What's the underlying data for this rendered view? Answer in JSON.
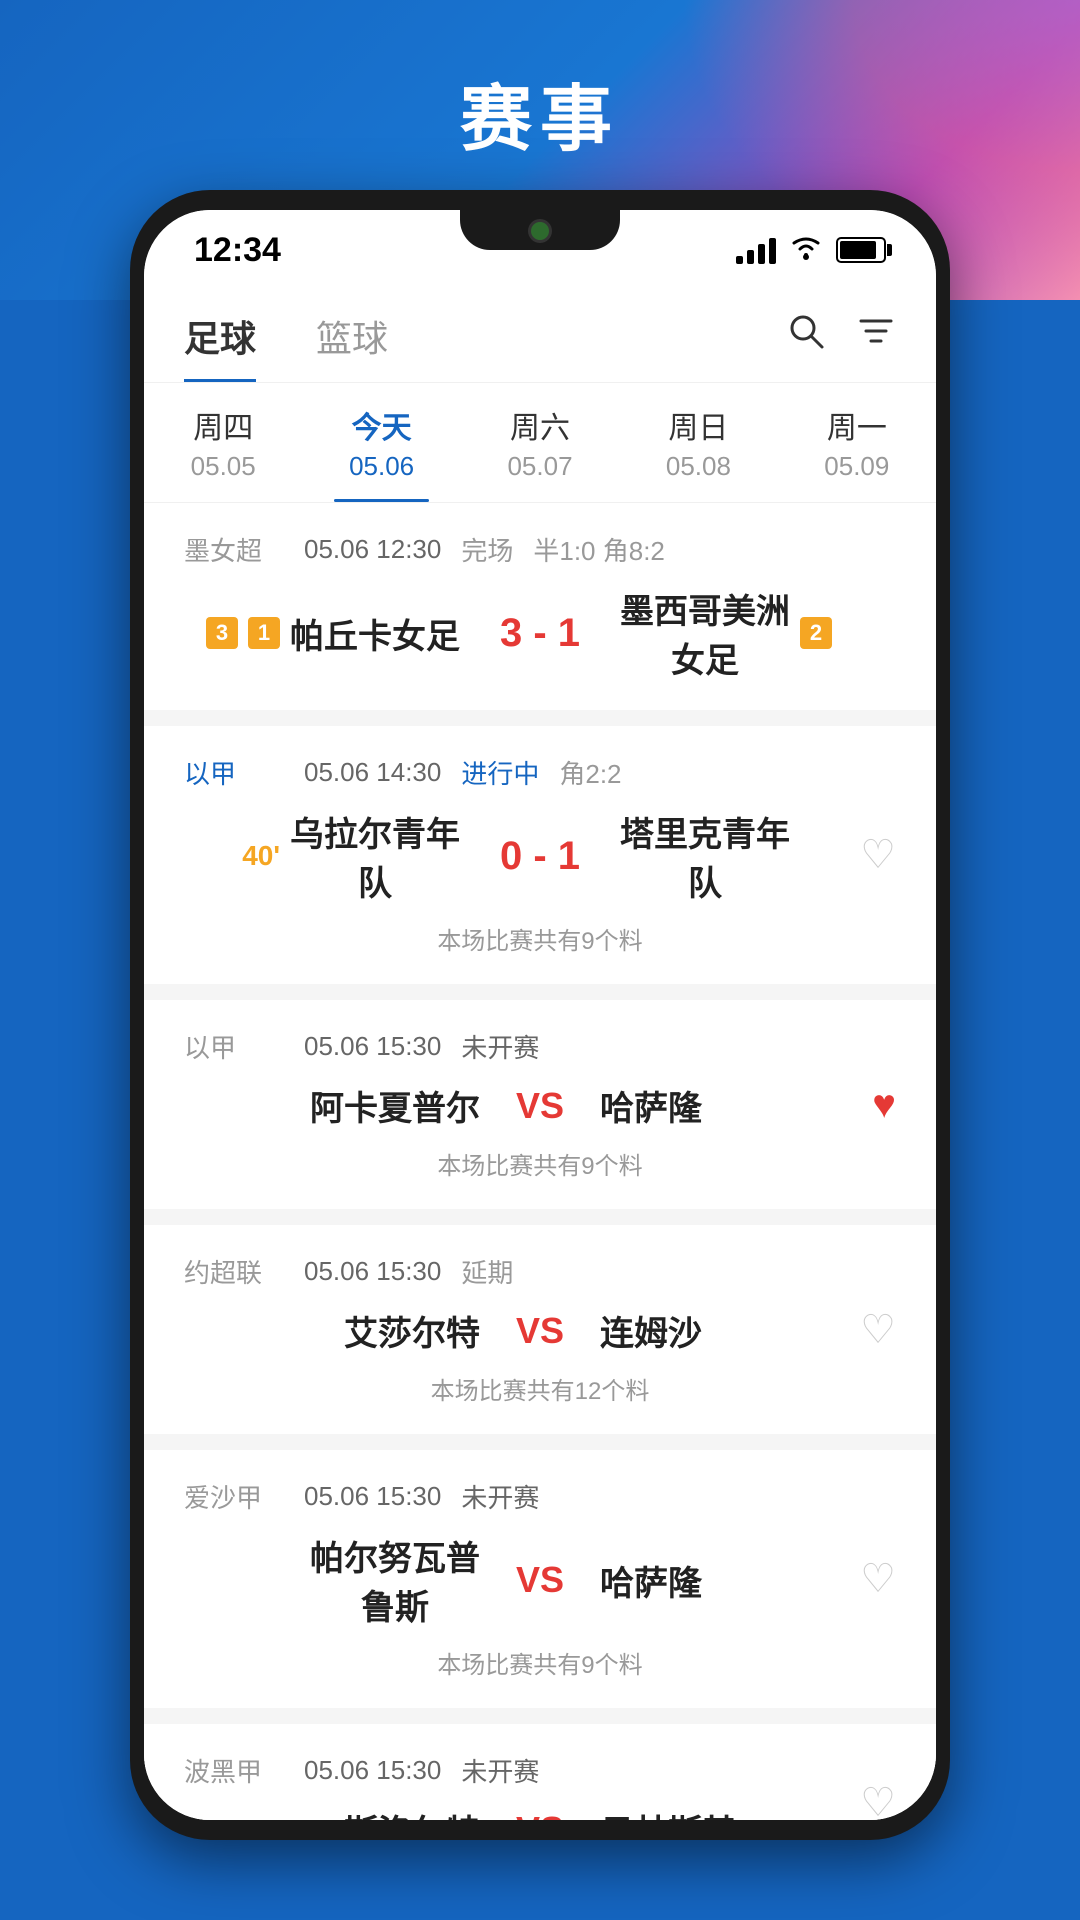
{
  "page": {
    "title": "赛事",
    "background_color": "#1565C0"
  },
  "status_bar": {
    "time": "12:34",
    "signal": "full",
    "wifi": true,
    "battery": 85
  },
  "nav": {
    "tabs": [
      {
        "label": "足球",
        "active": true
      },
      {
        "label": "篮球",
        "active": false
      }
    ],
    "icons": {
      "search": "🔍",
      "filter": "⛉"
    }
  },
  "day_tabs": [
    {
      "label": "周四",
      "date": "05.05",
      "active": false
    },
    {
      "label": "今天",
      "date": "05.06",
      "active": true
    },
    {
      "label": "周六",
      "date": "05.07",
      "active": false
    },
    {
      "label": "周日",
      "date": "05.08",
      "active": false
    },
    {
      "label": "周一",
      "date": "05.09",
      "active": false
    }
  ],
  "matches": [
    {
      "league": "墨女超",
      "league_blue": false,
      "date_time": "05.06 12:30",
      "status": "完场",
      "status_type": "finished",
      "extra": "半1:0 角8:2",
      "home_team": "帕丘卡女足",
      "home_rank": "3",
      "home_rank_color": "gold",
      "home_rank2": "1",
      "home_rank2_color": "orange",
      "away_team": "墨西哥美洲女足",
      "away_rank": "2",
      "away_rank_color": "orange",
      "score": "3 - 1",
      "score_type": "result",
      "tip": "",
      "fav": false,
      "show_fav": false,
      "live_time": ""
    },
    {
      "league": "以甲",
      "league_blue": true,
      "date_time": "05.06 14:30",
      "status": "进行中",
      "status_type": "live",
      "extra": "角2:2",
      "home_team": "乌拉尔青年队",
      "home_rank": "",
      "away_team": "塔里克青年队",
      "away_rank": "",
      "score": "0 - 1",
      "score_type": "result",
      "tip": "本场比赛共有9个料",
      "fav": false,
      "show_fav": true,
      "live_time": "40'"
    },
    {
      "league": "以甲",
      "league_blue": false,
      "date_time": "05.06 15:30",
      "status": "未开赛",
      "status_type": "upcoming",
      "extra": "",
      "home_team": "阿卡夏普尔",
      "home_rank": "",
      "away_team": "哈萨隆",
      "away_rank": "",
      "score": "",
      "vs": "VS",
      "tip": "本场比赛共有9个料",
      "fav": true,
      "show_fav": true,
      "live_time": ""
    },
    {
      "league": "约超联",
      "league_blue": false,
      "date_time": "05.06 15:30",
      "status": "延期",
      "status_type": "delayed",
      "extra": "",
      "home_team": "艾莎尔特",
      "home_rank": "",
      "away_team": "连姆沙",
      "away_rank": "",
      "score": "",
      "vs": "VS",
      "tip": "本场比赛共有12个料",
      "fav": false,
      "show_fav": true,
      "live_time": ""
    },
    {
      "league": "爱沙甲",
      "league_blue": false,
      "date_time": "05.06 15:30",
      "status": "未开赛",
      "status_type": "upcoming",
      "extra": "",
      "home_team": "帕尔努瓦普鲁斯",
      "home_rank": "",
      "away_team": "哈萨隆",
      "away_rank": "",
      "score": "",
      "vs": "VS",
      "tip": "本场比赛共有9个料",
      "fav": false,
      "show_fav": true,
      "live_time": ""
    },
    {
      "league": "波黑甲",
      "league_blue": false,
      "date_time": "05.06 15:30",
      "status": "未开赛",
      "status_type": "upcoming",
      "extra": "",
      "home_team": "斯洛尔特",
      "home_rank": "",
      "away_team": "日林斯基",
      "away_rank": "",
      "score": "",
      "vs": "VS",
      "tip": "",
      "fav": false,
      "show_fav": true,
      "live_time": ""
    }
  ]
}
